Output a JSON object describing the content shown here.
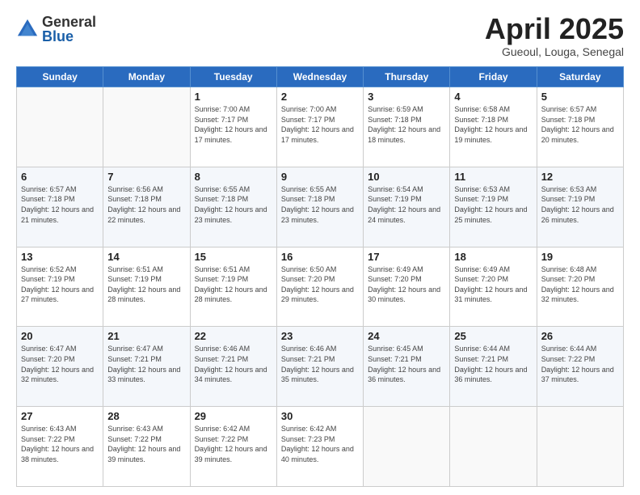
{
  "logo": {
    "general": "General",
    "blue": "Blue"
  },
  "title": {
    "month": "April 2025",
    "location": "Gueoul, Louga, Senegal"
  },
  "days_of_week": [
    "Sunday",
    "Monday",
    "Tuesday",
    "Wednesday",
    "Thursday",
    "Friday",
    "Saturday"
  ],
  "weeks": [
    [
      {
        "day": "",
        "info": ""
      },
      {
        "day": "",
        "info": ""
      },
      {
        "day": "1",
        "info": "Sunrise: 7:00 AM\nSunset: 7:17 PM\nDaylight: 12 hours and 17 minutes."
      },
      {
        "day": "2",
        "info": "Sunrise: 7:00 AM\nSunset: 7:17 PM\nDaylight: 12 hours and 17 minutes."
      },
      {
        "day": "3",
        "info": "Sunrise: 6:59 AM\nSunset: 7:18 PM\nDaylight: 12 hours and 18 minutes."
      },
      {
        "day": "4",
        "info": "Sunrise: 6:58 AM\nSunset: 7:18 PM\nDaylight: 12 hours and 19 minutes."
      },
      {
        "day": "5",
        "info": "Sunrise: 6:57 AM\nSunset: 7:18 PM\nDaylight: 12 hours and 20 minutes."
      }
    ],
    [
      {
        "day": "6",
        "info": "Sunrise: 6:57 AM\nSunset: 7:18 PM\nDaylight: 12 hours and 21 minutes."
      },
      {
        "day": "7",
        "info": "Sunrise: 6:56 AM\nSunset: 7:18 PM\nDaylight: 12 hours and 22 minutes."
      },
      {
        "day": "8",
        "info": "Sunrise: 6:55 AM\nSunset: 7:18 PM\nDaylight: 12 hours and 23 minutes."
      },
      {
        "day": "9",
        "info": "Sunrise: 6:55 AM\nSunset: 7:18 PM\nDaylight: 12 hours and 23 minutes."
      },
      {
        "day": "10",
        "info": "Sunrise: 6:54 AM\nSunset: 7:19 PM\nDaylight: 12 hours and 24 minutes."
      },
      {
        "day": "11",
        "info": "Sunrise: 6:53 AM\nSunset: 7:19 PM\nDaylight: 12 hours and 25 minutes."
      },
      {
        "day": "12",
        "info": "Sunrise: 6:53 AM\nSunset: 7:19 PM\nDaylight: 12 hours and 26 minutes."
      }
    ],
    [
      {
        "day": "13",
        "info": "Sunrise: 6:52 AM\nSunset: 7:19 PM\nDaylight: 12 hours and 27 minutes."
      },
      {
        "day": "14",
        "info": "Sunrise: 6:51 AM\nSunset: 7:19 PM\nDaylight: 12 hours and 28 minutes."
      },
      {
        "day": "15",
        "info": "Sunrise: 6:51 AM\nSunset: 7:19 PM\nDaylight: 12 hours and 28 minutes."
      },
      {
        "day": "16",
        "info": "Sunrise: 6:50 AM\nSunset: 7:20 PM\nDaylight: 12 hours and 29 minutes."
      },
      {
        "day": "17",
        "info": "Sunrise: 6:49 AM\nSunset: 7:20 PM\nDaylight: 12 hours and 30 minutes."
      },
      {
        "day": "18",
        "info": "Sunrise: 6:49 AM\nSunset: 7:20 PM\nDaylight: 12 hours and 31 minutes."
      },
      {
        "day": "19",
        "info": "Sunrise: 6:48 AM\nSunset: 7:20 PM\nDaylight: 12 hours and 32 minutes."
      }
    ],
    [
      {
        "day": "20",
        "info": "Sunrise: 6:47 AM\nSunset: 7:20 PM\nDaylight: 12 hours and 32 minutes."
      },
      {
        "day": "21",
        "info": "Sunrise: 6:47 AM\nSunset: 7:21 PM\nDaylight: 12 hours and 33 minutes."
      },
      {
        "day": "22",
        "info": "Sunrise: 6:46 AM\nSunset: 7:21 PM\nDaylight: 12 hours and 34 minutes."
      },
      {
        "day": "23",
        "info": "Sunrise: 6:46 AM\nSunset: 7:21 PM\nDaylight: 12 hours and 35 minutes."
      },
      {
        "day": "24",
        "info": "Sunrise: 6:45 AM\nSunset: 7:21 PM\nDaylight: 12 hours and 36 minutes."
      },
      {
        "day": "25",
        "info": "Sunrise: 6:44 AM\nSunset: 7:21 PM\nDaylight: 12 hours and 36 minutes."
      },
      {
        "day": "26",
        "info": "Sunrise: 6:44 AM\nSunset: 7:22 PM\nDaylight: 12 hours and 37 minutes."
      }
    ],
    [
      {
        "day": "27",
        "info": "Sunrise: 6:43 AM\nSunset: 7:22 PM\nDaylight: 12 hours and 38 minutes."
      },
      {
        "day": "28",
        "info": "Sunrise: 6:43 AM\nSunset: 7:22 PM\nDaylight: 12 hours and 39 minutes."
      },
      {
        "day": "29",
        "info": "Sunrise: 6:42 AM\nSunset: 7:22 PM\nDaylight: 12 hours and 39 minutes."
      },
      {
        "day": "30",
        "info": "Sunrise: 6:42 AM\nSunset: 7:23 PM\nDaylight: 12 hours and 40 minutes."
      },
      {
        "day": "",
        "info": ""
      },
      {
        "day": "",
        "info": ""
      },
      {
        "day": "",
        "info": ""
      }
    ]
  ]
}
